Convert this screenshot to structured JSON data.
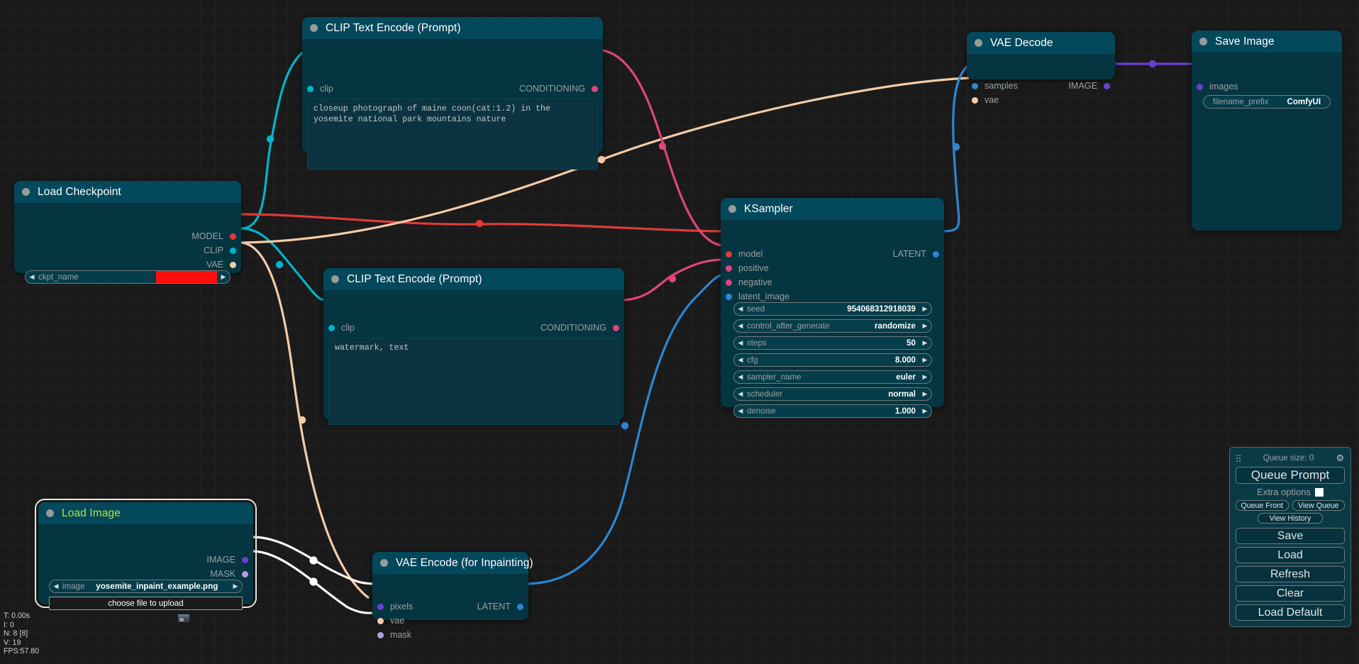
{
  "app": {
    "name": "ComfyUI"
  },
  "canvas": {
    "bg": "#1a1a1a",
    "grid": "#2a2a2a"
  },
  "stats": {
    "time": "T: 0.00s",
    "iterations": "I: 0",
    "nodes": "N: 8 [8]",
    "version": "V: 19",
    "fps": "FPS:57.80"
  },
  "link_colors": {
    "model": "#e03a3a",
    "clip": "#00b4cc",
    "vae": "#f5cba7",
    "conditioning": "#e0457b",
    "latent": "#2b87d4",
    "image": "#6a3fd1",
    "mask": "#b0a0e0",
    "selected": "#ffffff"
  },
  "nodes": {
    "clip_positive": {
      "title": "CLIP Text Encode (Prompt)",
      "inputs": [
        {
          "label": "clip",
          "color": "#00b4cc"
        }
      ],
      "outputs": [
        {
          "label": "CONDITIONING",
          "color": "#e0457b"
        }
      ],
      "text": "closeup photograph of maine coon(cat:1.2) in the\nyosemite national park mountains nature"
    },
    "clip_negative": {
      "title": "CLIP Text Encode (Prompt)",
      "inputs": [
        {
          "label": "clip",
          "color": "#00b4cc"
        }
      ],
      "outputs": [
        {
          "label": "CONDITIONING",
          "color": "#e0457b"
        }
      ],
      "text": "watermark, text"
    },
    "load_checkpoint": {
      "title": "Load Checkpoint",
      "outputs": [
        {
          "label": "MODEL",
          "color": "#e03a3a"
        },
        {
          "label": "CLIP",
          "color": "#00b4cc"
        },
        {
          "label": "VAE",
          "color": "#f5cba7"
        }
      ],
      "widget": {
        "name": "ckpt_name",
        "value": "",
        "error": true,
        "error_color": "#ff0e0e"
      }
    },
    "ksampler": {
      "title": "KSampler",
      "inputs": [
        {
          "label": "model",
          "color": "#e03a3a"
        },
        {
          "label": "positive",
          "color": "#e0457b"
        },
        {
          "label": "negative",
          "color": "#e0457b"
        },
        {
          "label": "latent_image",
          "color": "#2b87d4"
        }
      ],
      "outputs": [
        {
          "label": "LATENT",
          "color": "#2b87d4"
        }
      ],
      "widgets": [
        {
          "name": "seed",
          "value": "954068312918039"
        },
        {
          "name": "control_after_generate",
          "value": "randomize"
        },
        {
          "name": "steps",
          "value": "50"
        },
        {
          "name": "cfg",
          "value": "8.000"
        },
        {
          "name": "sampler_name",
          "value": "euler"
        },
        {
          "name": "scheduler",
          "value": "normal"
        },
        {
          "name": "denoise",
          "value": "1.000"
        }
      ]
    },
    "vae_decode": {
      "title": "VAE Decode",
      "inputs": [
        {
          "label": "samples",
          "color": "#2b87d4"
        },
        {
          "label": "vae",
          "color": "#f5cba7"
        }
      ],
      "outputs": [
        {
          "label": "IMAGE",
          "color": "#6a3fd1"
        }
      ]
    },
    "save_image": {
      "title": "Save Image",
      "inputs": [
        {
          "label": "images",
          "color": "#6a3fd1"
        }
      ],
      "widget": {
        "name": "filename_prefix",
        "value": "ComfyUI"
      }
    },
    "load_image": {
      "title": "Load Image",
      "selected": true,
      "title_color": "#aee63a",
      "outputs": [
        {
          "label": "IMAGE",
          "color": "#6a3fd1"
        },
        {
          "label": "MASK",
          "color": "#b0a0e0"
        }
      ],
      "widget": {
        "name": "image",
        "value": "yosemite_inpaint_example.png"
      },
      "upload_button": "choose file to upload"
    },
    "vae_encode_inpaint": {
      "title": "VAE Encode (for Inpainting)",
      "inputs": [
        {
          "label": "pixels",
          "color": "#6a3fd1"
        },
        {
          "label": "vae",
          "color": "#f5cba7"
        },
        {
          "label": "mask",
          "color": "#b0a0e0"
        }
      ],
      "outputs": [
        {
          "label": "LATENT",
          "color": "#2b87d4"
        }
      ]
    }
  },
  "menu": {
    "queue_size": "Queue size: 0",
    "queue_prompt": "Queue Prompt",
    "extra_options": "Extra options",
    "queue_front": "Queue Front",
    "view_queue": "View Queue",
    "view_history": "View History",
    "save": "Save",
    "load": "Load",
    "refresh": "Refresh",
    "clear": "Clear",
    "load_default": "Load Default",
    "gear_glyph": "⚙"
  },
  "glyphs": {
    "left": "◀",
    "right": "▶"
  }
}
